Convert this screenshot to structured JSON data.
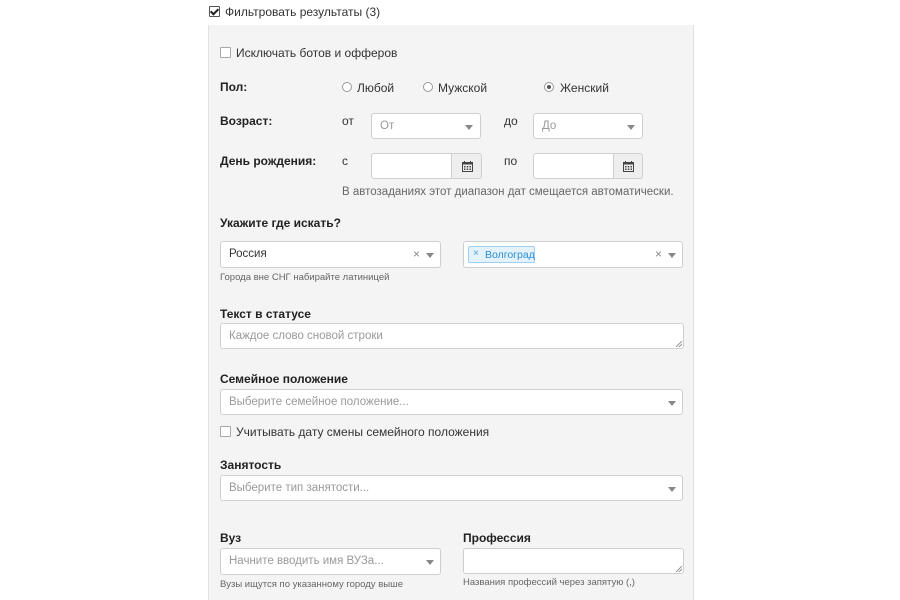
{
  "filter": {
    "label": "Фильтровать результаты (3)",
    "checked": true
  },
  "exclude_bots": {
    "label": "Исключать ботов и офферов",
    "checked": false
  },
  "gender": {
    "label": "Пол:",
    "options": [
      {
        "label": "Любой",
        "checked": false
      },
      {
        "label": "Мужской",
        "checked": false
      },
      {
        "label": "Женский",
        "checked": true
      }
    ]
  },
  "age": {
    "label": "Возраст:",
    "from_label": "от",
    "from_placeholder": "От",
    "to_label": "до",
    "to_placeholder": "До"
  },
  "birthday": {
    "label": "День рождения:",
    "from_label": "с",
    "to_label": "по",
    "note": "В автозаданиях этот диапазон дат смещается автоматически."
  },
  "location": {
    "label": "Укажите где искать?",
    "country_value": "Россия",
    "country_hint": "Города вне СНГ набирайте латиницей",
    "city_tag": "Волгоград"
  },
  "status_text": {
    "label": "Текст в статусе",
    "placeholder": "Каждое слово сновой строки"
  },
  "marital": {
    "label": "Семейное положение",
    "placeholder": "Выберите семейное положение...",
    "change_date_label": "Учитывать дату смены семейного положения",
    "change_date_checked": false
  },
  "employment": {
    "label": "Занятость",
    "placeholder": "Выберите тип занятости..."
  },
  "university": {
    "label": "Вуз",
    "placeholder": "Начните вводить имя ВУЗа...",
    "hint": "Вузы ищутся по указанному городу выше"
  },
  "profession": {
    "label": "Профессия",
    "hint": "Названия профессий через запятую (,)"
  },
  "icons": {
    "calendar": "calendar-icon",
    "clear": "clear-icon",
    "dropdown": "chevron-down-icon"
  }
}
